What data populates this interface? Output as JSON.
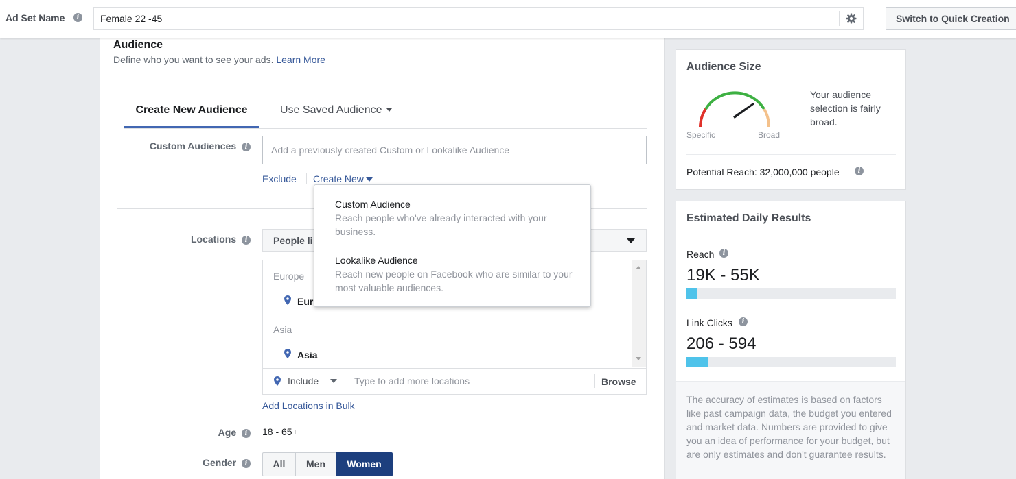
{
  "header": {
    "ad_set_label": "Ad Set Name",
    "ad_set_value": "Female 22 -45",
    "quick_creation_label": "Switch to Quick Creation"
  },
  "audience": {
    "title": "Audience",
    "subtitle": "Define who you want to see your ads.",
    "learn_more": "Learn More",
    "tabs": [
      {
        "label": "Create New Audience",
        "active": true
      },
      {
        "label": "Use Saved Audience",
        "active": false
      }
    ],
    "custom_audiences": {
      "label": "Custom Audiences",
      "placeholder": "Add a previously created Custom or Lookalike Audience",
      "exclude": "Exclude",
      "create_new": "Create New"
    },
    "dropdown": {
      "items": [
        {
          "title": "Custom Audience",
          "description": "Reach people who've already interacted with your business."
        },
        {
          "title": "Lookalike Audience",
          "description": "Reach new people on Facebook who are similar to your most valuable audiences."
        }
      ]
    },
    "locations": {
      "label": "Locations",
      "selected": "People li",
      "groups": [
        {
          "region": "Europe",
          "item": "Eur"
        },
        {
          "region": "Asia",
          "item": "Asia"
        }
      ],
      "include": "Include",
      "placeholder": "Type to add more locations",
      "browse": "Browse",
      "bulk": "Add Locations in Bulk"
    },
    "age": {
      "label": "Age",
      "value": "18 - 65+"
    },
    "gender": {
      "label": "Gender",
      "options": [
        "All",
        "Men",
        "Women"
      ],
      "selected": "Women"
    }
  },
  "audience_size": {
    "title": "Audience Size",
    "description": "Your audience selection is fairly broad.",
    "specific_label": "Specific",
    "broad_label": "Broad",
    "potential_reach": "Potential Reach: 32,000,000 people",
    "gauge_level": 0.72
  },
  "estimated": {
    "title": "Estimated Daily Results",
    "reach_label": "Reach",
    "reach_range": "19K - 55K",
    "reach_fill": 0.05,
    "clicks_label": "Link Clicks",
    "clicks_range": "206 - 594",
    "clicks_fill": 0.1,
    "note": "The accuracy of estimates is based on factors like past campaign data, the budget you entered and market data. Numbers are provided to give you an idea of performance for your budget, but are only estimates and don't guarantee results."
  },
  "colors": {
    "accent": "#4267b2",
    "selected_gender": "#1d3f7e",
    "bar_fill": "#4fc3ea",
    "link": "#365899"
  }
}
